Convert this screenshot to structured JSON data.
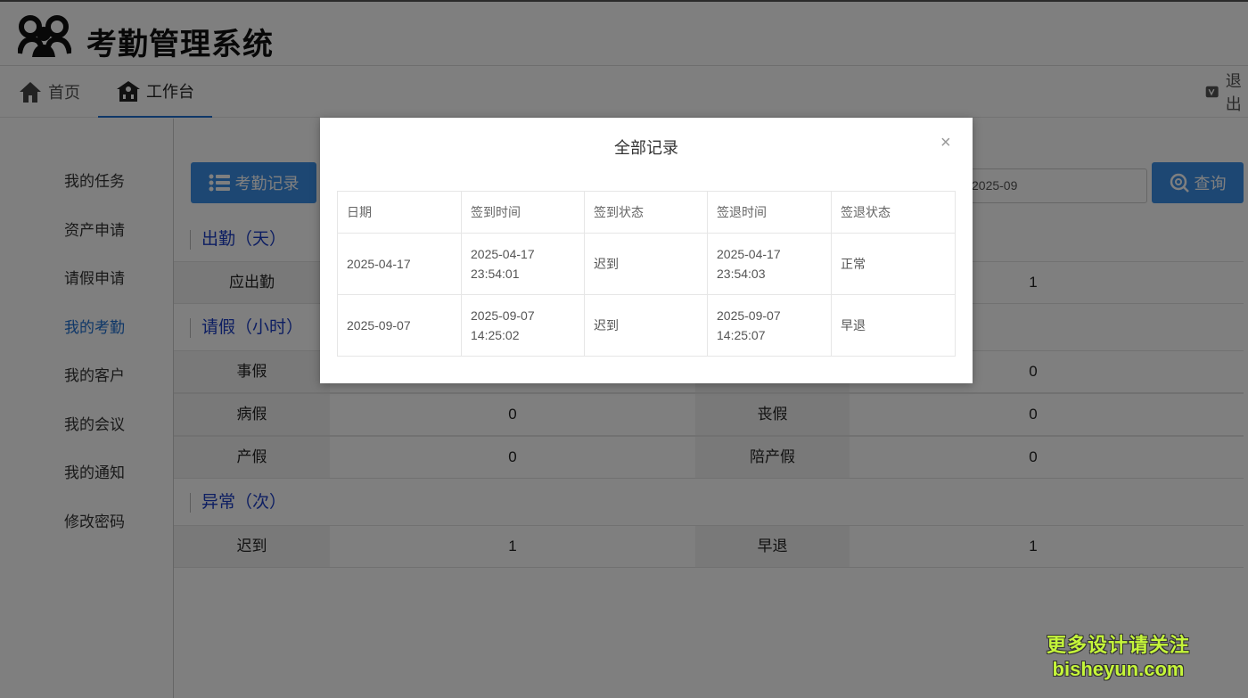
{
  "app": {
    "title": "考勤管理系统"
  },
  "nav": {
    "home": "首页",
    "workbench": "工作台",
    "exit": "退出"
  },
  "sidebar": {
    "items": [
      {
        "label": "我的任务"
      },
      {
        "label": "资产申请"
      },
      {
        "label": "请假申请"
      },
      {
        "label": "我的考勤"
      },
      {
        "label": "我的客户"
      },
      {
        "label": "我的会议"
      },
      {
        "label": "我的通知"
      },
      {
        "label": "修改密码"
      }
    ],
    "active_index": 3
  },
  "toolbar": {
    "records_label": "考勤记录",
    "month_value": "2025-09",
    "query_label": "查询"
  },
  "sections": {
    "attendance_title": "出勤（天）",
    "leave_title": "请假（小时）",
    "abnormal_title": "异常（次）"
  },
  "rows": {
    "attendance": [
      "应出勤",
      "",
      "",
      "1"
    ],
    "leave1": [
      "事假",
      "",
      "",
      "0"
    ],
    "leave2": [
      "病假",
      "0",
      "丧假",
      "0"
    ],
    "leave3": [
      "产假",
      "0",
      "陪产假",
      "0"
    ],
    "abnormal": [
      "迟到",
      "1",
      "早退",
      "1"
    ]
  },
  "modal": {
    "title": "全部记录",
    "close": "×",
    "headers": [
      "日期",
      "签到时间",
      "签到状态",
      "签退时间",
      "签退状态"
    ],
    "records": [
      [
        "2025-04-17",
        "2025-04-17 23:54:01",
        "迟到",
        "2025-04-17 23:54:03",
        "正常"
      ],
      [
        "2025-09-07",
        "2025-09-07 14:25:02",
        "迟到",
        "2025-09-07 14:25:07",
        "早退"
      ]
    ]
  },
  "watermark": {
    "line1": "更多设计请关注",
    "line2": "bisheyun.com"
  },
  "colors": {
    "primary": "#3b8fe6",
    "section_title": "#1a3cc4",
    "active_link": "#1e6fd0"
  },
  "icons": {
    "logo": "people-group-icon",
    "home": "house-icon",
    "workbench": "school-icon",
    "exit": "exit-icon",
    "records": "list-icon",
    "query": "search-icon",
    "calendar": "calendar-icon"
  }
}
